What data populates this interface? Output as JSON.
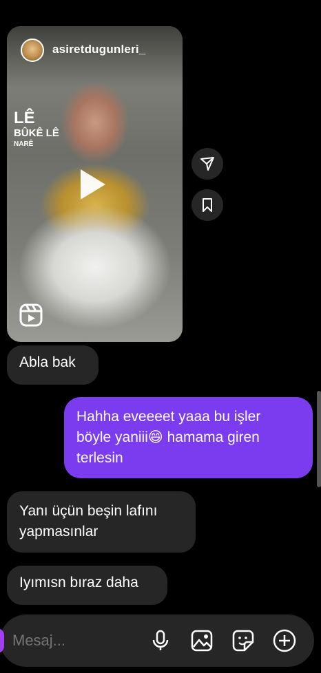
{
  "reel": {
    "username": "asiretdugunleri_",
    "overlay_title": "LÊ",
    "overlay_subtitle": "BÛKÊ LÊ",
    "overlay_artist": "NARÊ"
  },
  "messages": [
    {
      "type": "received",
      "text": "Abla bak"
    },
    {
      "type": "sent",
      "lines": [
        "Hahha eveeeet yaaa bu işler",
        "böyle yaniii😄  hamama giren",
        "terlesin"
      ]
    },
    {
      "type": "received",
      "lines": [
        "Yanı üçün beşin lafını",
        "yapmasınlar"
      ]
    },
    {
      "type": "received",
      "text": "Iyımısn bıraz daha"
    }
  ],
  "composer": {
    "placeholder": "Mesaj..."
  },
  "icons": {
    "share": "send-icon",
    "save": "bookmark-icon",
    "reels": "reels-icon",
    "play": "play-icon",
    "mic": "microphone-icon",
    "gallery": "image-icon",
    "sticker": "sticker-icon",
    "add": "plus-circle-icon"
  },
  "colors": {
    "sent_bubble": "#7b3cf0",
    "received_bubble": "#262626",
    "background": "#000000"
  }
}
